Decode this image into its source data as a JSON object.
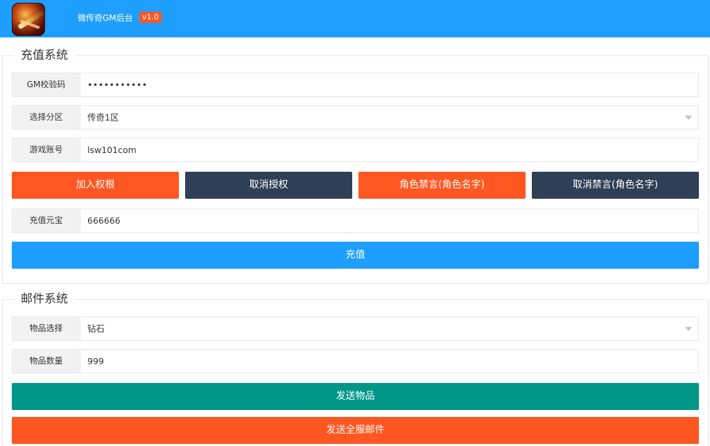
{
  "header": {
    "title": "微传奇GM后台",
    "version": "v1.0"
  },
  "recharge": {
    "legend": "充值系统",
    "gm_code": {
      "label": "GM校验码",
      "value": "•••••••••••"
    },
    "zone": {
      "label": "选择分区",
      "value": "传奇1区"
    },
    "account": {
      "label": "游戏账号",
      "value": "lsw101com"
    },
    "buttons": {
      "add_permission": "加入权根",
      "cancel_permission": "取消授权",
      "ban_chat": "角色禁言(角色名字)",
      "unban_chat": "取消禁言(角色名字)"
    },
    "amount": {
      "label": "充值元宝",
      "value": "666666"
    },
    "submit": "充值"
  },
  "mail": {
    "legend": "邮件系统",
    "item": {
      "label": "物品选择",
      "value": "钻石"
    },
    "quantity": {
      "label": "物品数量",
      "value": "999"
    },
    "send_item": "发送物品",
    "send_all": "发送全服邮件"
  },
  "colors": {
    "header_blue": "#1e9fff",
    "orange": "#ff5722",
    "dark": "#2f4056",
    "green": "#009688"
  }
}
